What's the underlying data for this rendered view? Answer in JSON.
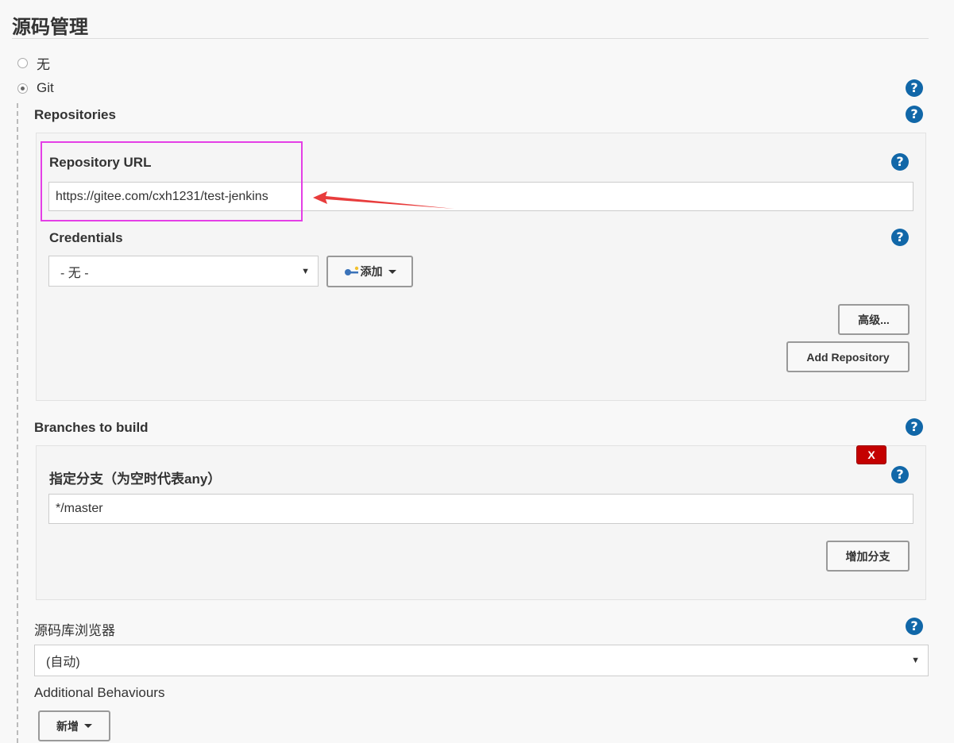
{
  "section": {
    "title": "源码管理"
  },
  "scm_options": [
    {
      "label": "无",
      "selected": false
    },
    {
      "label": "Git",
      "selected": true
    }
  ],
  "repositories": {
    "label": "Repositories",
    "url_label": "Repository URL",
    "url_value": "https://gitee.com/cxh1231/test-jenkins",
    "credentials_label": "Credentials",
    "credentials_selected": "- 无 -",
    "add_button": "添加",
    "advanced_button": "高级...",
    "add_repo_button": "Add Repository"
  },
  "branches": {
    "label": "Branches to build",
    "delete_button": "X",
    "branch_label": "指定分支（为空时代表any）",
    "branch_value": "*/master",
    "add_branch_button": "增加分支"
  },
  "browser": {
    "label": "源码库浏览器",
    "selected": "(自动)"
  },
  "behaviours": {
    "label": "Additional Behaviours",
    "add_button": "新增"
  },
  "help_glyph": "?",
  "colors": {
    "help_blue": "#1167a8",
    "highlight": "#e43fe6",
    "arrow": "#e83c3c",
    "delete_red": "#c40000"
  }
}
